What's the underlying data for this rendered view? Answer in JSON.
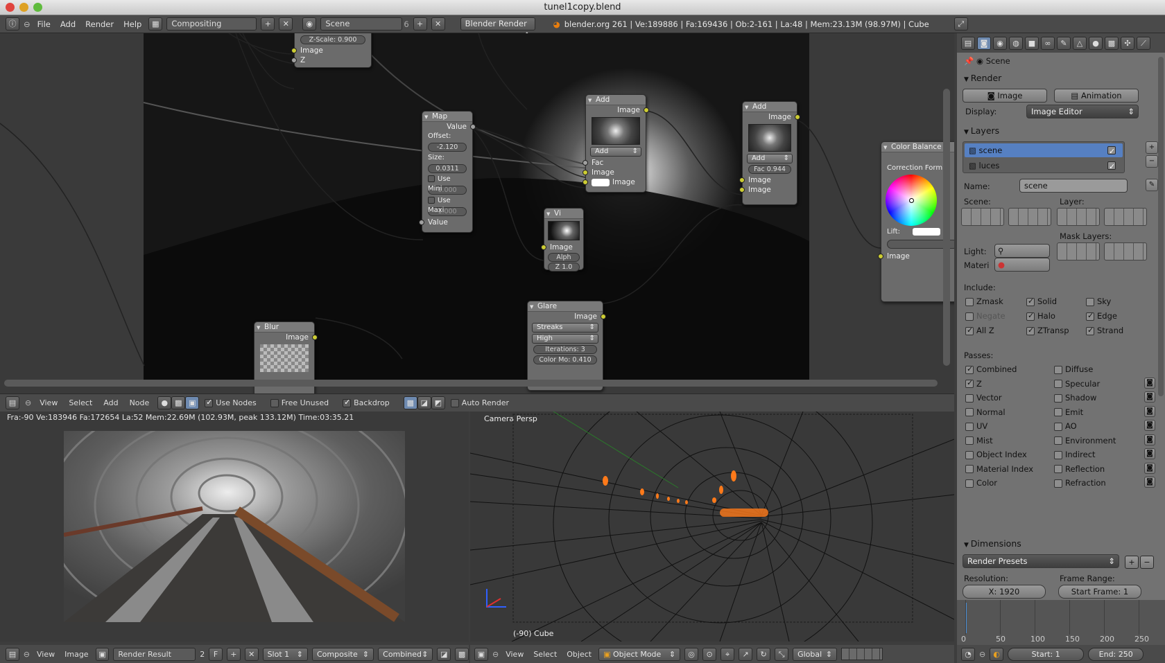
{
  "window_title": "tunel1copy.blend",
  "main_header": {
    "menus": [
      "File",
      "Add",
      "Render",
      "Help"
    ],
    "screen_layout": "Compositing",
    "scene_name": "Scene",
    "scene_users": "6",
    "render_engine": "Blender Render",
    "stats": "blender.org 261 | Ve:189886 | Fa:169436 | Ob:2-161 | La:48 | Mem:23.13M (98.97M) | Cube"
  },
  "nodes": {
    "zscale": {
      "field": "Z-Scale: 0.900",
      "out_image": "Image",
      "out_z": "Z"
    },
    "map": {
      "title": "Map",
      "out_value": "Value",
      "offset_label": "Offset:",
      "offset": "-2.120",
      "size_label": "Size:",
      "size": "0.0311",
      "use_min": "Use Mini",
      "min": "0.000",
      "use_max": "Use Maxi",
      "max": "1.000",
      "in_value": "Value"
    },
    "add1": {
      "title": "Add",
      "out_image": "Image",
      "mode": "Add",
      "in_fac": "Fac",
      "in_image1": "Image",
      "in_image2": "Image"
    },
    "add2": {
      "title": "Add",
      "out_image": "Image",
      "mode": "Add",
      "fac": "Fac 0.944",
      "in_image1": "Image",
      "in_image2": "Image"
    },
    "viewer": {
      "title": "Vi",
      "in_image": "Image",
      "in_alpha": "Alph",
      "in_z": "Z 1.0"
    },
    "glare": {
      "title": "Glare",
      "out_image": "Image",
      "type": "Streaks",
      "quality": "High",
      "iterations": "Iterations: 3",
      "color_mod": "Color Mo: 0.410"
    },
    "blur": {
      "title": "Blur",
      "out_image": "Image"
    },
    "color_balance": {
      "title": "Color Balance",
      "correction": "Correction Form",
      "lift": "Lift:",
      "in_image": "Image"
    }
  },
  "node_header": {
    "menus": [
      "View",
      "Select",
      "Add",
      "Node"
    ],
    "use_nodes": "Use Nodes",
    "free_unused": "Free Unused",
    "backdrop": "Backdrop",
    "auto_render": "Auto Render"
  },
  "image_editor": {
    "stats": "Fra:-90  Ve:183946 Fa:172654 La:52 Mem:22.69M (102.93M, peak 133.12M) Time:03:35.21",
    "menus": [
      "View",
      "Image"
    ],
    "image_name": "Render Result",
    "users": "2",
    "fake": "F",
    "slot": "Slot 1",
    "layer": "Composite",
    "pass": "Combined"
  },
  "view3d": {
    "label": "Camera Persp",
    "object_label": "(-90) Cube",
    "menus": [
      "View",
      "Select",
      "Object"
    ],
    "mode": "Object Mode",
    "orientation": "Global"
  },
  "properties": {
    "context_name": "Scene",
    "render_panel": "Render",
    "image_btn": "Image",
    "animation_btn": "Animation",
    "display_label": "Display:",
    "display_value": "Image Editor",
    "layers_panel": "Layers",
    "layers": [
      {
        "name": "scene",
        "checked": true
      },
      {
        "name": "luces",
        "checked": true
      }
    ],
    "name_label": "Name:",
    "name_value": "scene",
    "scene_label": "Scene:",
    "layer_label": "Layer:",
    "mask_layers_label": "Mask Layers:",
    "light_label": "Light:",
    "material_label": "Materi",
    "include_label": "Include:",
    "include": [
      {
        "label": "Zmask",
        "on": false
      },
      {
        "label": "Solid",
        "on": true
      },
      {
        "label": "Sky",
        "on": false
      },
      {
        "label": "Negate",
        "on": false
      },
      {
        "label": "Halo",
        "on": true
      },
      {
        "label": "Edge",
        "on": true
      },
      {
        "label": "All Z",
        "on": true
      },
      {
        "label": "ZTransp",
        "on": true
      },
      {
        "label": "Strand",
        "on": true
      }
    ],
    "passes_label": "Passes:",
    "passes_left": [
      {
        "label": "Combined",
        "on": true
      },
      {
        "label": "Z",
        "on": true
      },
      {
        "label": "Vector",
        "on": false
      },
      {
        "label": "Normal",
        "on": false
      },
      {
        "label": "UV",
        "on": false
      },
      {
        "label": "Mist",
        "on": false
      },
      {
        "label": "Object Index",
        "on": false
      },
      {
        "label": "Material Index",
        "on": false
      },
      {
        "label": "Color",
        "on": false
      }
    ],
    "passes_right": [
      {
        "label": "Diffuse",
        "on": false
      },
      {
        "label": "Specular",
        "on": false
      },
      {
        "label": "Shadow",
        "on": false
      },
      {
        "label": "Emit",
        "on": false
      },
      {
        "label": "AO",
        "on": false
      },
      {
        "label": "Environment",
        "on": false
      },
      {
        "label": "Indirect",
        "on": false
      },
      {
        "label": "Reflection",
        "on": false
      },
      {
        "label": "Refraction",
        "on": false
      }
    ],
    "dimensions_panel": "Dimensions",
    "render_presets": "Render Presets",
    "resolution_label": "Resolution:",
    "resolution_x": "X: 1920",
    "frame_range_label": "Frame Range:",
    "start_frame": "Start Frame: 1"
  },
  "timeline": {
    "ticks": [
      "0",
      "50",
      "100",
      "150",
      "200",
      "250"
    ],
    "start": "Start: 1",
    "end": "End: 250"
  }
}
